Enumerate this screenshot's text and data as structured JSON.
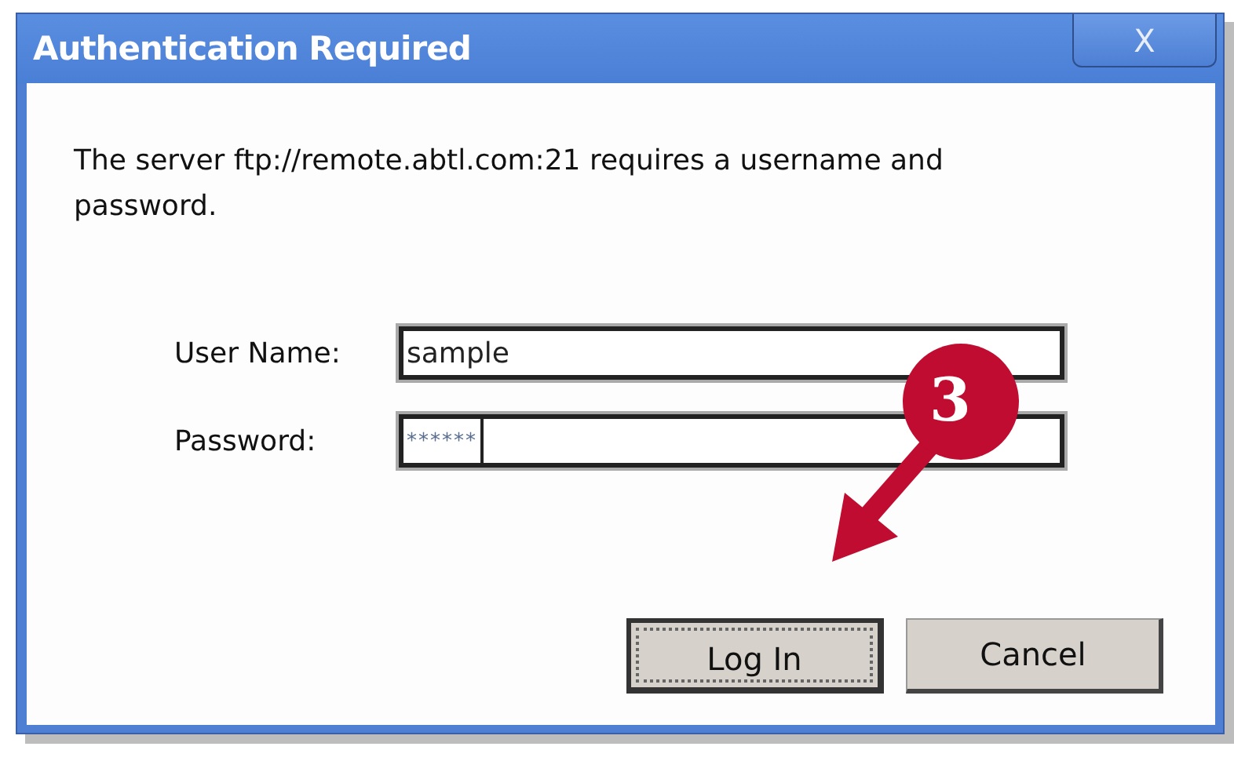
{
  "window": {
    "title": "Authentication Required",
    "close": "X"
  },
  "message": "The server ftp://remote.abtl.com:21 requires a username and password.",
  "fields": [
    {
      "label": "User Name:",
      "value": "sample",
      "focused": false
    },
    {
      "label": "Password:",
      "value": "******",
      "focused": true
    }
  ],
  "buttons": [
    {
      "label": "Log In",
      "default": true
    },
    {
      "label": "Cancel",
      "default": false
    }
  ],
  "callout": {
    "number": "3"
  }
}
